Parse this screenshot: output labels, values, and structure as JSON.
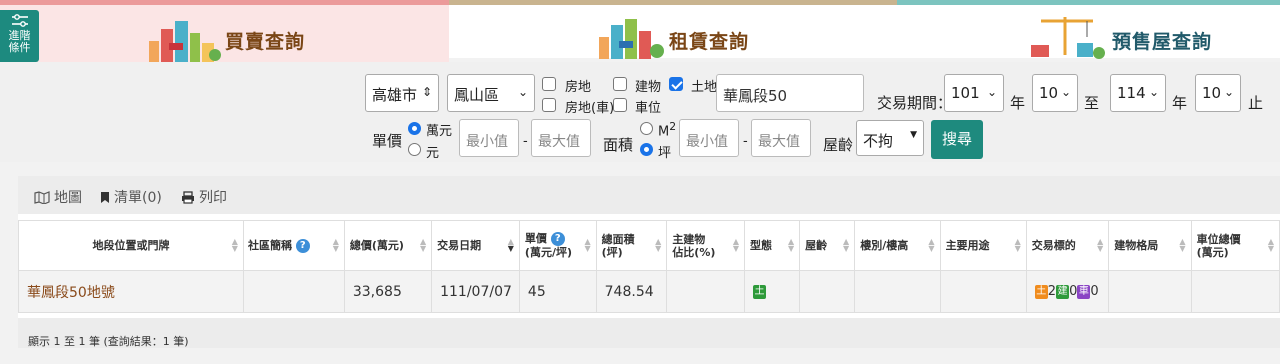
{
  "tabs": [
    {
      "label": "買賣查詢"
    },
    {
      "label": "租賃查詢"
    },
    {
      "label": "預售屋查詢"
    }
  ],
  "advanced": {
    "label_line1": "進階",
    "label_line2": "條件"
  },
  "filter": {
    "city": "高雄市",
    "district": "鳳山區",
    "types": {
      "house_land": "房地",
      "building": "建物",
      "land": "土地",
      "house_land_car": "房地(車)",
      "parking": "車位"
    },
    "keyword": "華鳳段50",
    "period_label": "交易期間：",
    "start_year": "101",
    "start_month": "10",
    "end_year": "114",
    "end_month": "10",
    "year_unit": "年",
    "to": "至",
    "stop": "止",
    "unit_price_label": "單價",
    "unit_wan": "萬元",
    "unit_yuan": "元",
    "min_placeholder": "最小值",
    "max_placeholder": "最大值",
    "dash": "-",
    "area_label": "面積",
    "area_m2": "M",
    "area_m2_sup": "2",
    "area_ping": "坪",
    "age_label": "屋齡",
    "age_value": "不拘",
    "search_btn": "搜尋"
  },
  "toolbar": {
    "map": "地圖",
    "list": "清單(0)",
    "print": "列印"
  },
  "table": {
    "headers": {
      "location": "地段位置或門牌",
      "community": "社區簡稱",
      "total_price": "總價(萬元)",
      "trade_date": "交易日期",
      "unit_price_1": "單價",
      "unit_price_2": "(萬元/坪)",
      "total_area_1": "總面積",
      "total_area_2": "(坪)",
      "main_ratio_1": "主建物",
      "main_ratio_2": "佔比(%)",
      "type": "型態",
      "age": "屋齡",
      "floor": "樓別/樓高",
      "usage": "主要用途",
      "target": "交易標的",
      "layout": "建物格局",
      "parking_1": "車位總價",
      "parking_2": "(萬元)"
    },
    "rows": [
      {
        "location": "華鳳段50地號",
        "community": "",
        "total_price": "33,685",
        "trade_date": "111/07/07",
        "unit_price": "45",
        "total_area": "748.54",
        "main_ratio": "",
        "type_icon": "土",
        "age": "",
        "floor": "",
        "usage": "",
        "target": {
          "land_tag": "土",
          "land_count": "2",
          "bldg_tag": "建",
          "bldg_count": "0",
          "car_tag": "車",
          "car_count": "0"
        },
        "layout": "",
        "parking": ""
      }
    ]
  },
  "footer": "顯示 1 至 1 筆 (查詢結果：1 筆)",
  "colors": {
    "accent": "#1e8a7e",
    "link": "#8a4a1a",
    "land": "#2e9a3a",
    "land_target": "#f08c1e",
    "bldg": "#2e9a3a",
    "car": "#8a44c4"
  }
}
